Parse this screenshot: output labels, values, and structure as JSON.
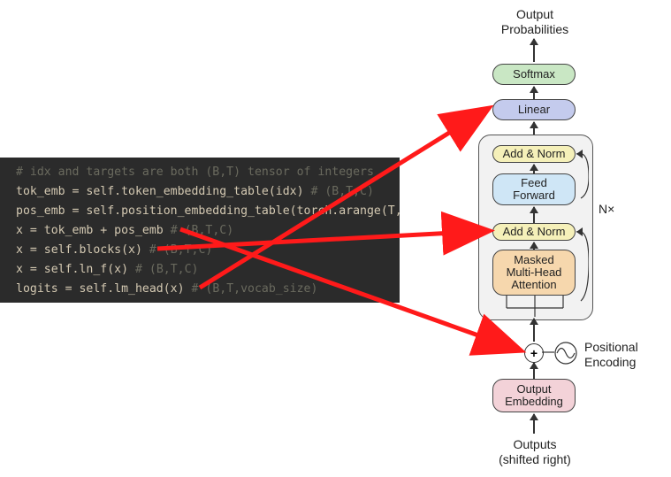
{
  "code": {
    "lines": [
      {
        "comment": "# idx and targets are both (B,T) tensor of integers",
        "stmt": ""
      },
      {
        "stmt": "tok_emb = self.token_embedding_table(idx)",
        "comment": "# (B,T,C)"
      },
      {
        "stmt": "pos_emb = self.position_embedding_table(torch.arange(T, de",
        "comment": ""
      },
      {
        "stmt": "x = tok_emb + pos_emb",
        "comment": "# (B,T,C)"
      },
      {
        "stmt": "x = self.blocks(x)",
        "comment": "# (B,T,C)"
      },
      {
        "stmt": "x = self.ln_f(x)",
        "comment": "# (B,T,C)"
      },
      {
        "stmt": "logits = self.lm_head(x)",
        "comment": "# (B,T,vocab_size)"
      }
    ]
  },
  "arch": {
    "top_label": "Output\nProbabilities",
    "softmax": "Softmax",
    "linear": "Linear",
    "addnorm1": "Add & Norm",
    "ffwd": "Feed\nForward",
    "addnorm2": "Add & Norm",
    "mha": "Masked\nMulti-Head\nAttention",
    "nx": "N×",
    "pos_enc": "Positional\nEncoding",
    "out_emb": "Output\nEmbedding",
    "bottom_label": "Outputs\n(shifted right)"
  },
  "colors": {
    "softmax": "#c9e7c4",
    "linear": "#c4cbed",
    "addnorm": "#f5f0b9",
    "ffwd": "#cfe6f6",
    "mha": "#f6d7ad",
    "outemb": "#f3d2d8",
    "arrow": "#ff1a1a"
  },
  "mappings": [
    {
      "from_line": 3,
      "to_component": "positional-encoding"
    },
    {
      "from_line": 4,
      "to_component": "add-norm-2"
    },
    {
      "from_line": 6,
      "to_component": "linear"
    }
  ]
}
